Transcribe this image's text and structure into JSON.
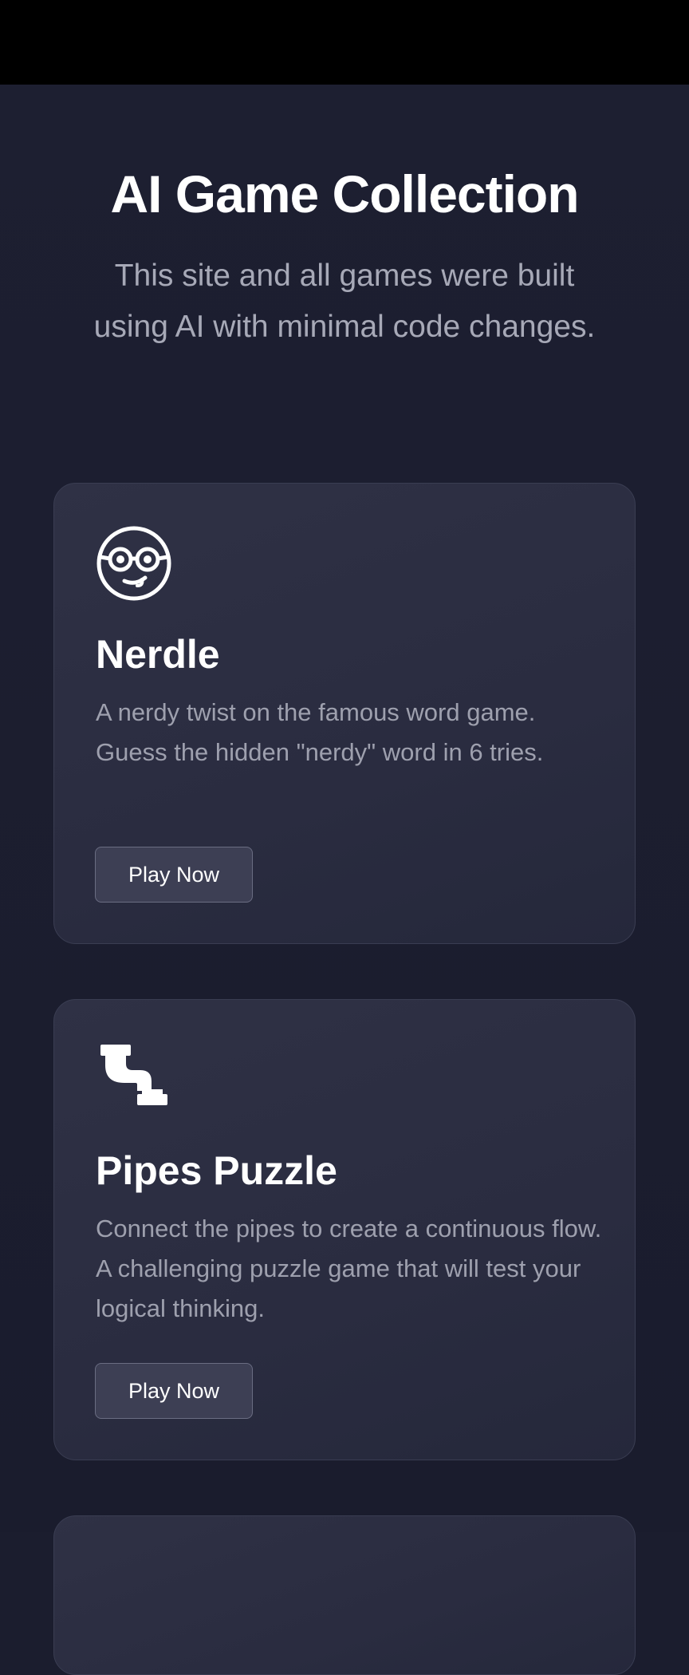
{
  "header": {
    "title": "AI Game Collection",
    "subtitle": "This site and all games were built using AI with minimal code changes."
  },
  "games": [
    {
      "icon": "nerd-face-icon",
      "title": "Nerdle",
      "description": "A nerdy twist on the famous word game. Guess the hidden \"nerdy\" word in 6 tries.",
      "button_label": "Play Now"
    },
    {
      "icon": "pipe-icon",
      "title": "Pipes Puzzle",
      "description": "Connect the pipes to create a continuous flow. A challenging puzzle game that will test your logical thinking.",
      "button_label": "Play Now"
    }
  ],
  "colors": {
    "background": "#1b1d2e",
    "card": "#2d2f43",
    "text_muted": "#9ea0ae",
    "button": "#3d3f54"
  }
}
